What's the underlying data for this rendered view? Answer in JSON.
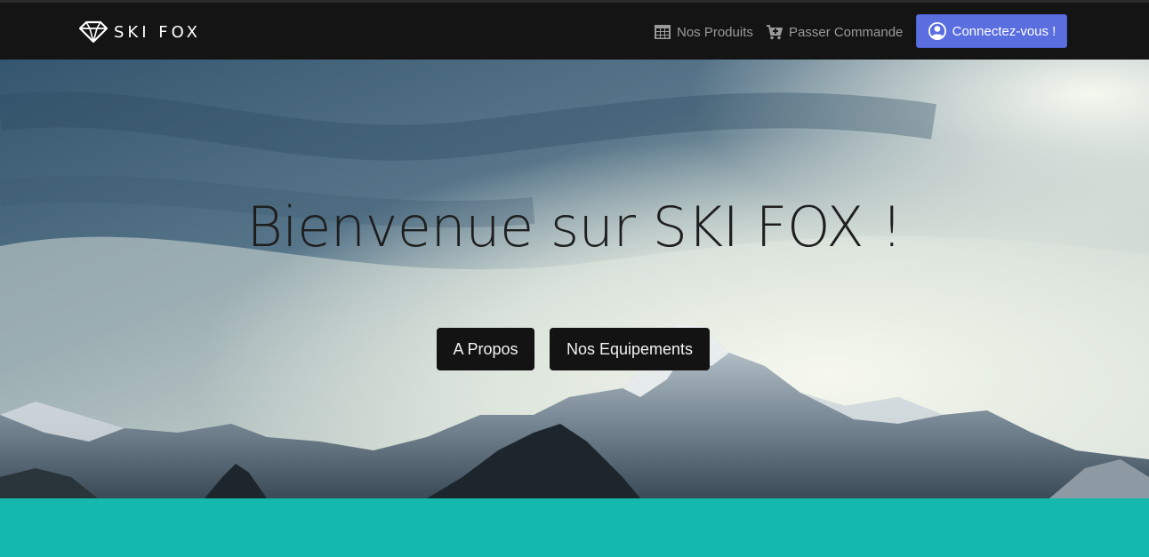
{
  "navbar": {
    "brand": "SKI FOX",
    "brand_icon": "diamond-icon",
    "links": [
      {
        "label": "Nos Produits",
        "icon": "table-icon"
      },
      {
        "label": "Passer Commande",
        "icon": "cart-icon"
      }
    ],
    "login_label": "Connectez-vous !",
    "login_icon": "user-circle-icon"
  },
  "hero": {
    "title": "Bienvenue sur SKI FOX !",
    "buttons": [
      {
        "label": "A Propos"
      },
      {
        "label": "Nos Equipements"
      }
    ]
  },
  "colors": {
    "navbar_bg": "#141414",
    "login_bg": "#5a6ee0",
    "section_bg": "#14b8ad",
    "hero_button_bg": "#131313"
  }
}
